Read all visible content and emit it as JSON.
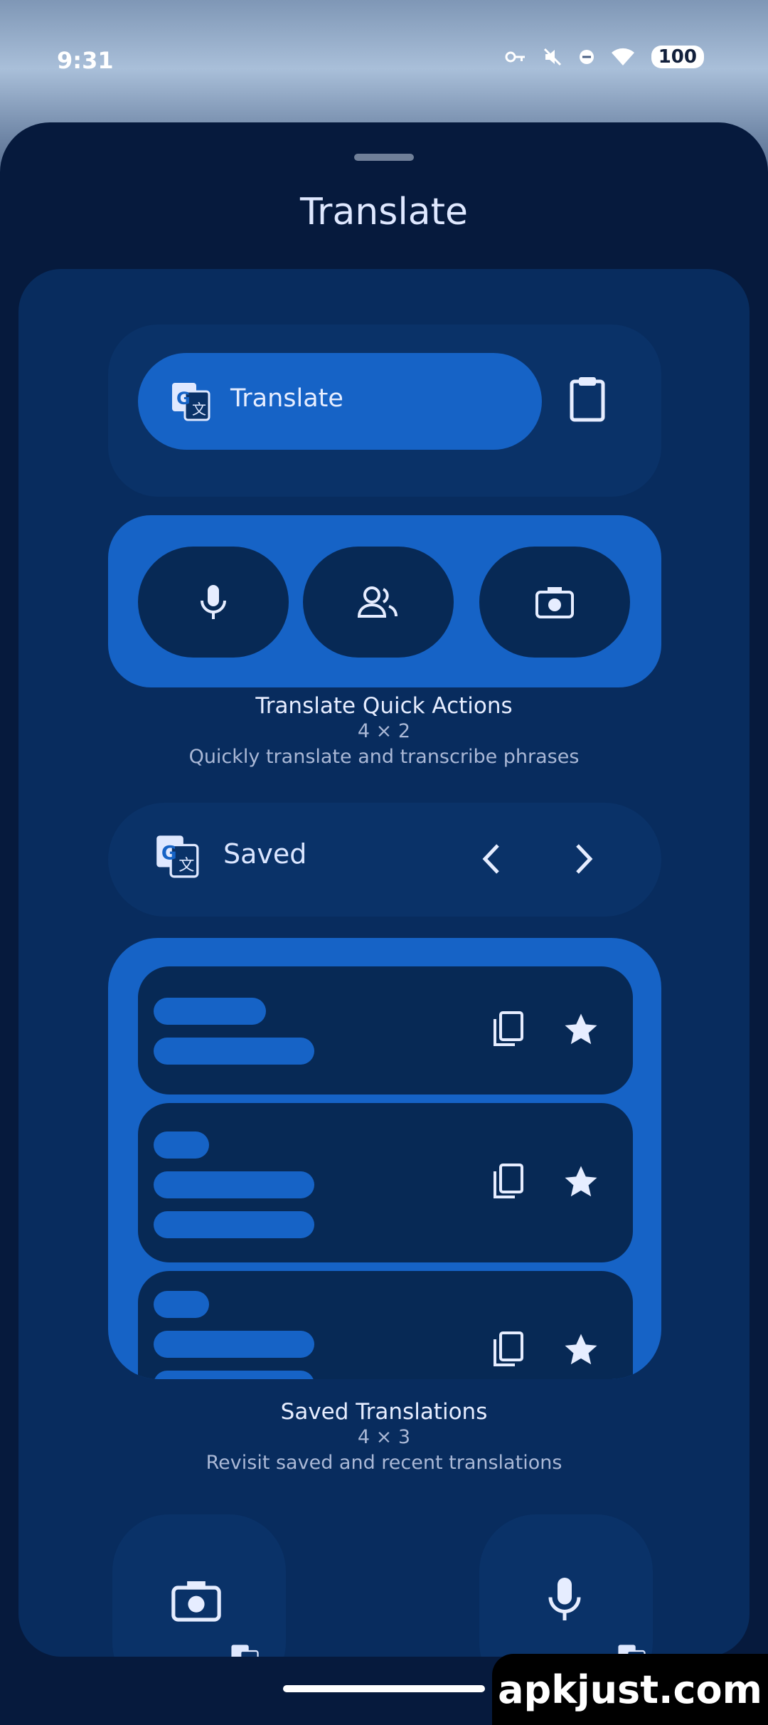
{
  "status_bar": {
    "time": "9:31",
    "battery": "100"
  },
  "sheet": {
    "title": "Translate"
  },
  "quick_actions": {
    "translate_label": "Translate",
    "widget_title": "Translate Quick Actions",
    "size": "4 × 2",
    "description": "Quickly translate and transcribe phrases"
  },
  "saved": {
    "label": "Saved",
    "widget_title": "Saved Translations",
    "size": "4 × 3",
    "description": "Revisit saved and recent translations"
  },
  "watermark": "apkjust.com",
  "colors": {
    "accent": "#1663c6",
    "panel": "#082c5e",
    "sheet": "#061a3d",
    "text": "#dfe8ff"
  }
}
